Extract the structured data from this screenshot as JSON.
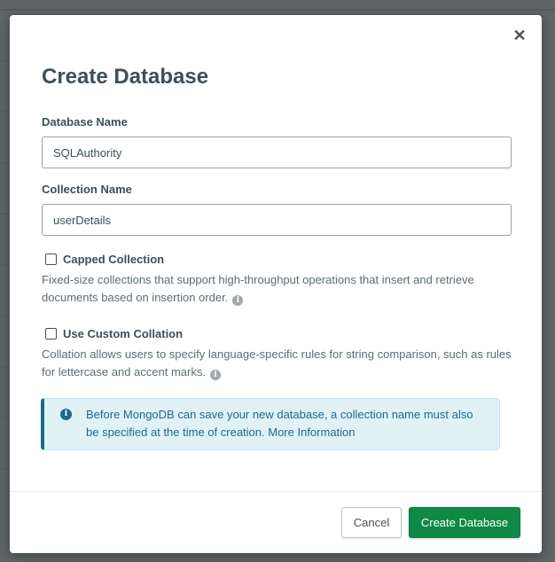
{
  "dialog": {
    "title": "Create Database",
    "close_icon": "close-icon",
    "database_name": {
      "label": "Database Name",
      "value": "SQLAuthority"
    },
    "collection_name": {
      "label": "Collection Name",
      "value": "userDetails"
    },
    "capped_collection": {
      "label": "Capped Collection",
      "checked": false,
      "description": "Fixed-size collections that support high-throughput operations that insert and retrieve documents based on insertion order."
    },
    "custom_collation": {
      "label": "Use Custom Collation",
      "checked": false,
      "description": "Collation allows users to specify language-specific rules for string comparison, such as rules for lettercase and accent marks."
    },
    "info_banner": {
      "text": "Before MongoDB can save your new database, a collection name must also be specified at the time of creation.",
      "link": "More Information",
      "icon": "info-icon"
    },
    "buttons": {
      "cancel": "Cancel",
      "create": "Create Database"
    }
  },
  "colors": {
    "primary_button": "#0f8a45",
    "banner_background": "#e1f2f6",
    "banner_accent": "#1a6a8e",
    "heading_text": "#3d4f58"
  }
}
